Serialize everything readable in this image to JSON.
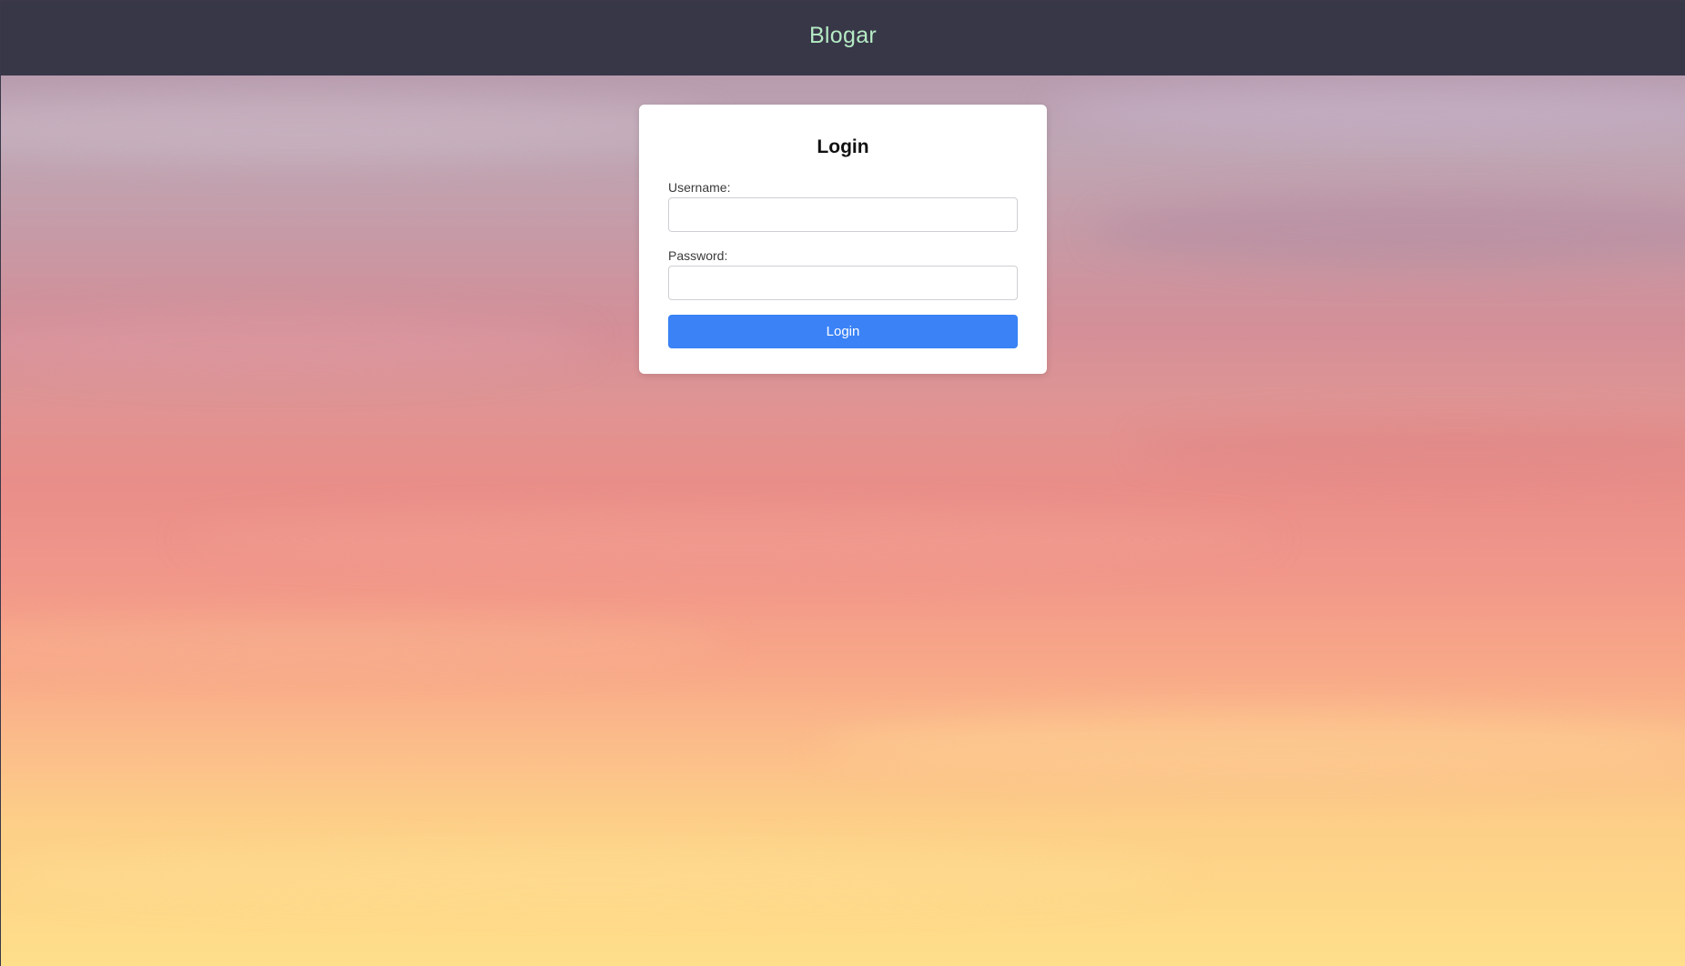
{
  "header": {
    "brand": "Blogar"
  },
  "login_form": {
    "title": "Login",
    "username": {
      "label": "Username:",
      "value": "",
      "placeholder": ""
    },
    "password": {
      "label": "Password:",
      "value": "",
      "placeholder": ""
    },
    "submit_label": "Login"
  },
  "colors": {
    "navbar_background": "#383748",
    "brand_text": "#b5ebc4",
    "card_background": "#ffffff",
    "button_background": "#3a82f6",
    "button_text": "#ffffff"
  }
}
